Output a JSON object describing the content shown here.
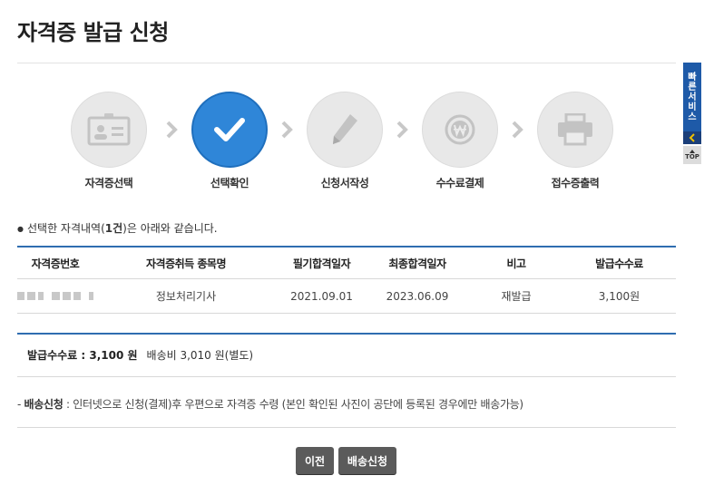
{
  "page": {
    "title": "자격증 발급 신청"
  },
  "steps": [
    {
      "label": "자격증선택",
      "icon": "id-card-icon",
      "active": false
    },
    {
      "label": "선택확인",
      "icon": "checkmark-icon",
      "active": true
    },
    {
      "label": "신청서작성",
      "icon": "pencil-icon",
      "active": false
    },
    {
      "label": "수수료결제",
      "icon": "won-coin-icon",
      "active": false
    },
    {
      "label": "접수증출력",
      "icon": "printer-icon",
      "active": false
    }
  ],
  "selection_info": {
    "prefix": "선택한 자격내역(",
    "count": "1건",
    "suffix": ")은 아래와 같습니다."
  },
  "table": {
    "headers": [
      "자격증번호",
      "자격증취득 종목명",
      "필기합격일자",
      "최종합격일자",
      "비고",
      "발급수수료"
    ],
    "rows": [
      {
        "cert_number": "(redacted)",
        "name": "정보처리기사",
        "written_pass_date": "2021.09.01",
        "final_pass_date": "2023.06.09",
        "note": "재발급",
        "fee": "3,100원"
      }
    ]
  },
  "fees": {
    "issue_fee_label": "발급수수료 : 3,100 원",
    "shipping_label": "배송비 3,010 원(별도)"
  },
  "delivery_note": {
    "prefix": "- ",
    "title": "배송신청",
    "text": " : 인터넷으로 신청(결제)후 우편으로 자격증 수령 (본인 확인된 사진이 공단에 등록된 경우에만 배송가능)"
  },
  "buttons": {
    "prev": "이전",
    "ship": "배송신청"
  },
  "quick_menu": {
    "label_chars": [
      "빠",
      "른",
      "서",
      "비",
      "스"
    ],
    "top": "TOP"
  },
  "colors": {
    "accent": "#2f86d8",
    "table_rule": "#2f6db0",
    "button": "#5b5b5b",
    "quick_menu": "#1e5aa8"
  }
}
